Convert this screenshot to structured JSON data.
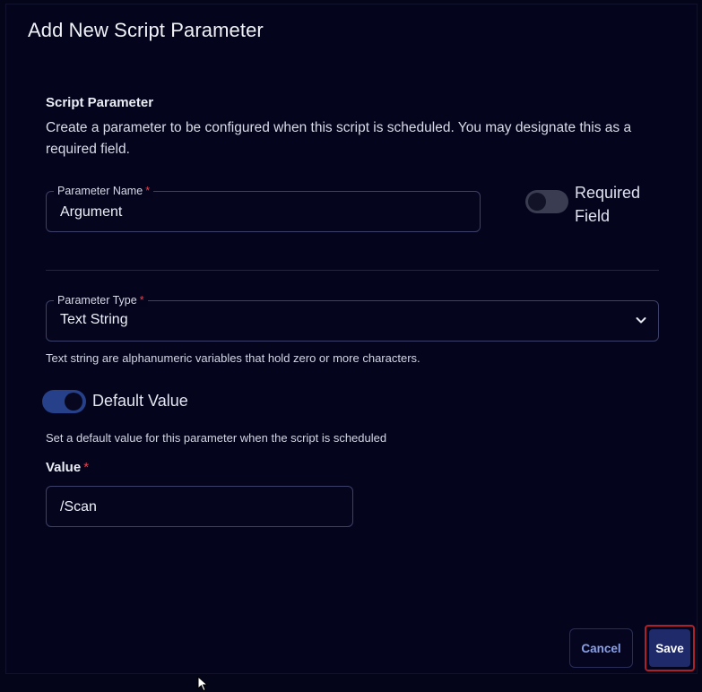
{
  "dialog": {
    "title": "Add New Script Parameter"
  },
  "section": {
    "heading": "Script Parameter",
    "description": "Create a parameter to be configured when this script is scheduled. You may designate this as a required field."
  },
  "parameter_name": {
    "label": "Parameter Name",
    "required_marker": "*",
    "value": "Argument"
  },
  "required_field": {
    "label": "Required Field",
    "enabled": false
  },
  "parameter_type": {
    "label": "Parameter Type",
    "required_marker": "*",
    "selected": "Text String",
    "help": "Text string are alphanumeric variables that hold zero or more characters."
  },
  "default_value": {
    "label": "Default Value",
    "enabled": true,
    "help": "Set a default value for this parameter when the script is scheduled"
  },
  "value_field": {
    "label": "Value",
    "required_marker": "*",
    "value": "/Scan"
  },
  "buttons": {
    "cancel": "Cancel",
    "save": "Save"
  },
  "colors": {
    "background": "#04041c",
    "accent": "#1f2a6a",
    "required": "#e2454f",
    "cancel_text": "#8aa0e6"
  }
}
